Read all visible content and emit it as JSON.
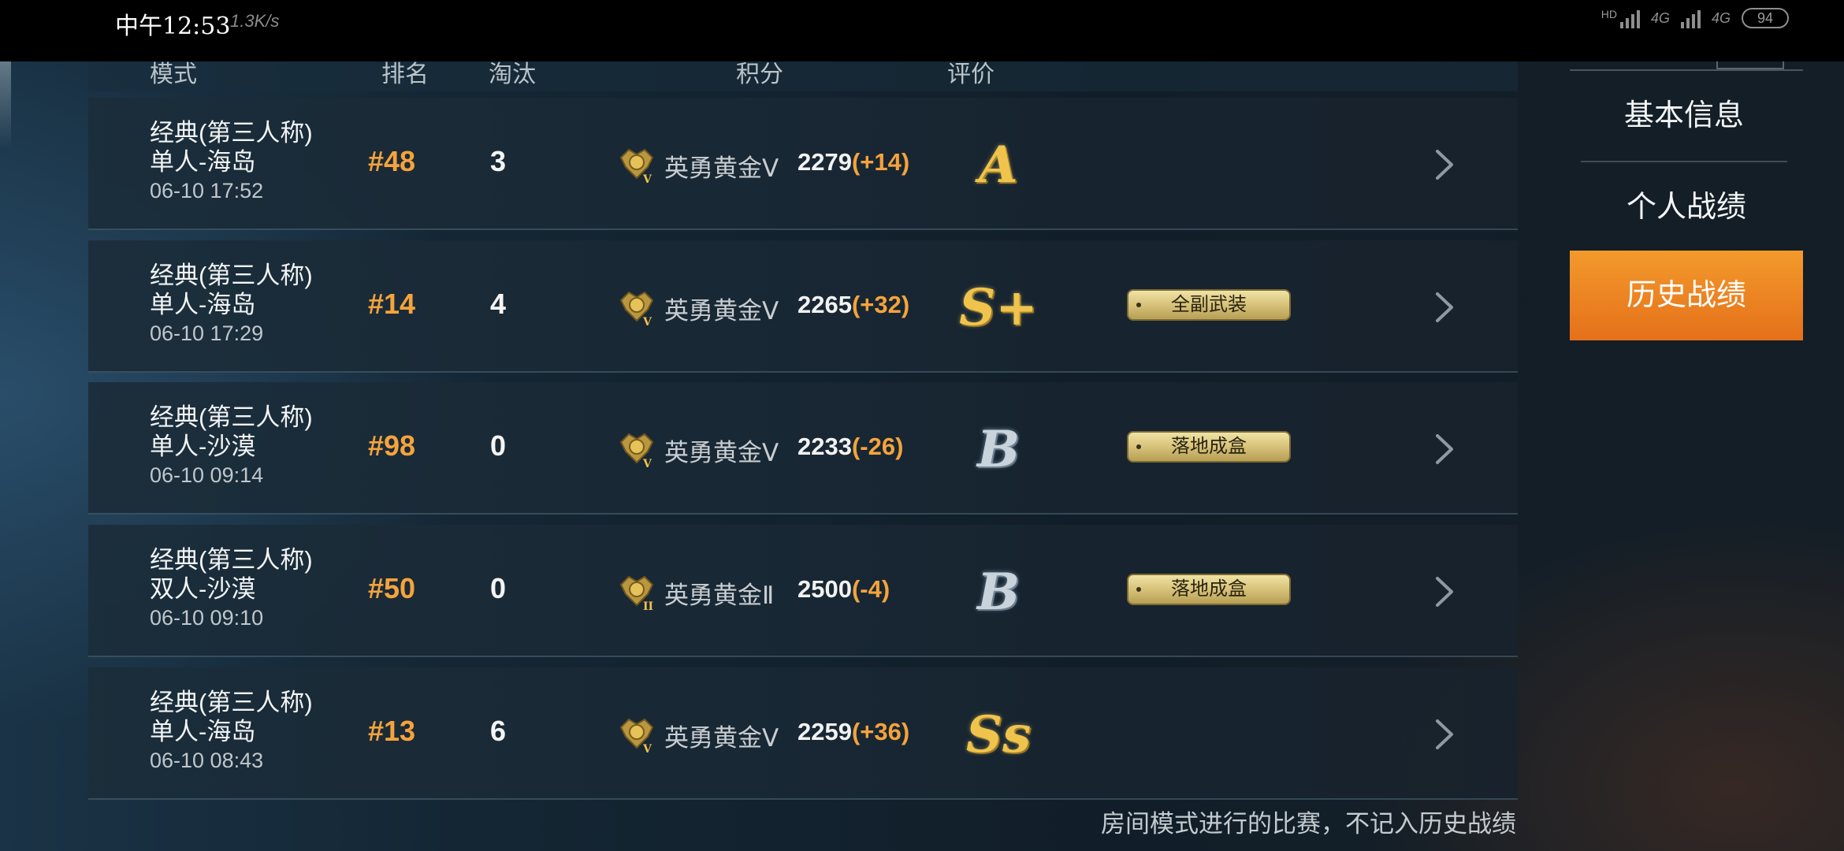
{
  "status": {
    "time": "中午12:53",
    "speed": "1.3K/s",
    "net1": "4G",
    "net2": "4G",
    "hd": "HD",
    "battery": "94"
  },
  "table": {
    "headers": {
      "mode": "模式",
      "rank": "排名",
      "kills": "淘汰",
      "score": "积分",
      "grade": "评价"
    },
    "rows": [
      {
        "mode": "经典(第三人称)",
        "map": "单人-海岛",
        "date": "06-10 17:52",
        "rank": "#48",
        "kills": "3",
        "tier": "英勇黄金Ⅴ",
        "tier_level": "V",
        "score": "2279",
        "delta": "(+14)",
        "grade": "A",
        "grade_style": "gold",
        "badge": ""
      },
      {
        "mode": "经典(第三人称)",
        "map": "单人-海岛",
        "date": "06-10 17:29",
        "rank": "#14",
        "kills": "4",
        "tier": "英勇黄金Ⅴ",
        "tier_level": "V",
        "score": "2265",
        "delta": "(+32)",
        "grade": "S+",
        "grade_style": "gold",
        "badge": "全副武装"
      },
      {
        "mode": "经典(第三人称)",
        "map": "单人-沙漠",
        "date": "06-10 09:14",
        "rank": "#98",
        "kills": "0",
        "tier": "英勇黄金Ⅴ",
        "tier_level": "V",
        "score": "2233",
        "delta": "(-26)",
        "grade": "B",
        "grade_style": "silver",
        "badge": "落地成盒"
      },
      {
        "mode": "经典(第三人称)",
        "map": "双人-沙漠",
        "date": "06-10 09:10",
        "rank": "#50",
        "kills": "0",
        "tier": "英勇黄金Ⅱ",
        "tier_level": "II",
        "score": "2500",
        "delta": "(-4)",
        "grade": "B",
        "grade_style": "silver",
        "badge": "落地成盒"
      },
      {
        "mode": "经典(第三人称)",
        "map": "单人-海岛",
        "date": "06-10 08:43",
        "rank": "#13",
        "kills": "6",
        "tier": "英勇黄金Ⅴ",
        "tier_level": "V",
        "score": "2259",
        "delta": "(+36)",
        "grade": "Ss",
        "grade_style": "gold",
        "badge": ""
      }
    ]
  },
  "side": {
    "tabs": [
      "基本信息",
      "个人战绩",
      "历史战绩"
    ],
    "active": 2
  },
  "footnote": "房间模式进行的比赛，不记入历史战绩",
  "colors": {
    "accent": "#f5a33c",
    "active_tab": "#e5701a"
  }
}
